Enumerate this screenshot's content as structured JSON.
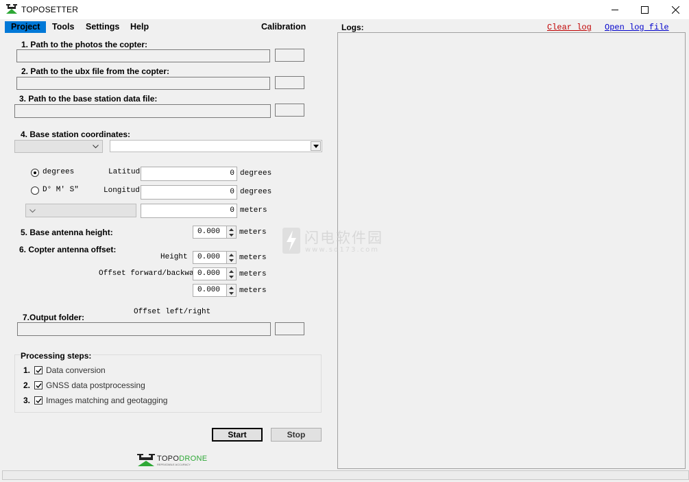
{
  "window": {
    "title": "TOPOSETTER",
    "controls": {
      "minimize": "minimize-icon",
      "maximize": "maximize-icon",
      "close": "close-icon"
    }
  },
  "menu": {
    "items": [
      "Project",
      "Tools",
      "Settings",
      "Help"
    ],
    "calibration": "Calibration"
  },
  "logs": {
    "label": "Logs:",
    "clear_log": "Clear log",
    "open_log_file": "Open log file",
    "clear_color": "#c00000",
    "open_color": "#0000cc"
  },
  "paths": {
    "photos_label": "1. Path to the photos the copter:",
    "ubx_label": "2. Path to the ubx file from the copter:",
    "base_label": "3. Path to the base station data file:"
  },
  "base_coords": {
    "label": "4. Base station coordinates:",
    "degrees_radio": "degrees",
    "dms_radio": "D° M′ S″",
    "latitude_label": "Latitud",
    "longitude_label": "Longitud",
    "latitude_value": "0",
    "longitude_value": "0",
    "height_value": "0",
    "unit_degrees": "degrees",
    "unit_meters": "meters"
  },
  "antenna": {
    "base_label": "5. Base antenna height:",
    "base_value": "0.000",
    "copter_label": "6. Copter antenna offset:",
    "height_label": "Height",
    "offset_fb_label": "Offset forward/backward",
    "offset_lr_label": "Offset left/right",
    "height_value": "0.000",
    "fb_value": "0.000",
    "lr_value": "0.000",
    "unit": "meters"
  },
  "output": {
    "label": "7.Output folder:"
  },
  "processing": {
    "label": "Processing steps:",
    "steps": [
      {
        "num": "1.",
        "text": "Data conversion",
        "checked": true
      },
      {
        "num": "2.",
        "text": "GNSS data postprocessing",
        "checked": true
      },
      {
        "num": "3.",
        "text": "Images matching and geotagging",
        "checked": true
      }
    ]
  },
  "actions": {
    "start": "Start",
    "stop": "Stop"
  },
  "logo": {
    "brand_a": "TOPO",
    "brand_b": "DRONE",
    "tagline": "REPEATABLE ACCURACY",
    "green": "#2ea836"
  },
  "watermark": {
    "text": "闪电软件园",
    "url": "www.sd173.com"
  },
  "colors": {
    "accent": "#0078d7"
  }
}
